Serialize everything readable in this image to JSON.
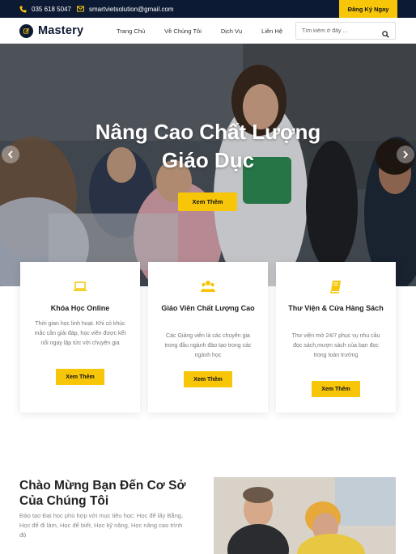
{
  "topbar": {
    "phone": "035 618 5047",
    "email": "smartvietsolution@gmail.com",
    "register_label": "Đăng Ký Ngay"
  },
  "nav": {
    "logo_text": "Mastery",
    "links": [
      "Trang Chủ",
      "Về Chúng Tôi",
      "Dịch Vụ",
      "Liên Hệ"
    ],
    "search_placeholder": "Tìm kiếm ở đây ..."
  },
  "hero": {
    "title_line1": "Nâng Cao Chất Lượng",
    "title_line2": "Giáo Dục",
    "button_label": "Xem Thêm"
  },
  "cards": [
    {
      "icon": "laptop-icon",
      "title": "Khóa Học Online",
      "desc": "Thời gian học linh hoạt. Khi có khúc mắc cần giải đáp, học viên được kết nối ngay lập tức với chuyên gia",
      "button_label": "Xem Thêm"
    },
    {
      "icon": "users-icon",
      "title": "Giáo Viên Chất Lượng Cao",
      "desc": "Các Giảng viên là các chuyên gia trong đầu ngành đào tạo trong các ngành học",
      "button_label": "Xem Thêm"
    },
    {
      "icon": "book-icon",
      "title": "Thư Viện & Cửa Hàng Sách",
      "desc": "Thư viện mở 24/7 phục vụ nhu cầu đọc sách,mượn sách của bạn đọc trong toàn trường",
      "button_label": "Xem Thêm"
    }
  ],
  "welcome": {
    "title": "Chào Mừng Bạn Đến Cơ Sở Của Chúng Tôi",
    "desc": "Đào tạo Đại học phù hợp với mục tiêu học: Học để lấy Bằng, Học để đi làm, Học để biết, Học kỹ năng, Học nâng cao trình độ"
  },
  "colors": {
    "navy": "#0d1a33",
    "accent": "#f7c609"
  }
}
